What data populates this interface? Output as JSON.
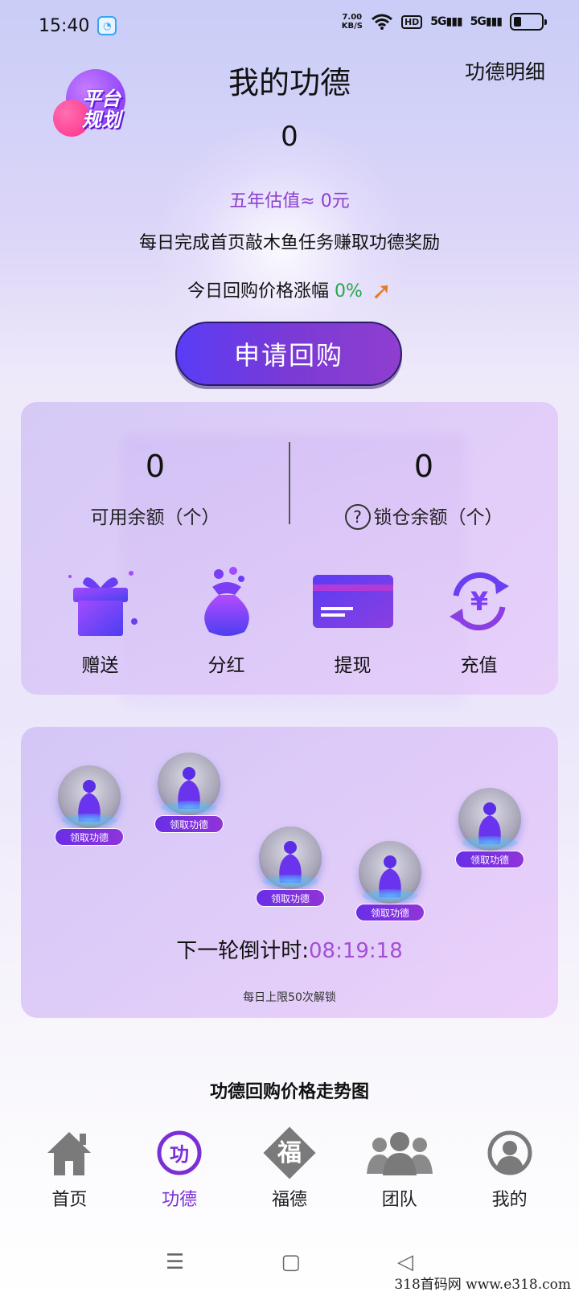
{
  "status_bar": {
    "time": "15:40",
    "net_speed_value": "7.00",
    "net_speed_unit": "KB/S",
    "icons": [
      "wifi-icon",
      "hd-icon",
      "signal-5g-icon",
      "signal-5g-icon",
      "battery-icon"
    ]
  },
  "header": {
    "title": "我的功德",
    "detail_link": "功德明细",
    "badge_text_line1": "平台",
    "badge_text_line2": "规划"
  },
  "merit": {
    "value": "0",
    "estimate": "五年估值≈ 0元",
    "tip": "每日完成首页敲木鱼任务赚取功德奖励",
    "price_rise_label": "今日回购价格涨幅",
    "price_rise_pct": "0%"
  },
  "buyback_button": "申请回购",
  "balance": {
    "available_value": "0",
    "available_label": "可用余额（个）",
    "locked_value": "0",
    "locked_label": "锁仓余额（个）"
  },
  "actions": [
    {
      "label": "赠送",
      "icon": "gift-icon"
    },
    {
      "label": "分红",
      "icon": "money-bag-icon"
    },
    {
      "label": "提现",
      "icon": "card-icon"
    },
    {
      "label": "充值",
      "icon": "yen-exchange-icon"
    }
  ],
  "collect": {
    "tag_label": "领取功德",
    "countdown_label": "下一轮倒计时:",
    "countdown_time": "08:19:18",
    "unlock_note": "每日上限50次解锁"
  },
  "trend_title": "功德回购价格走势图",
  "nav": [
    {
      "label": "首页",
      "icon": "home-icon",
      "active": false
    },
    {
      "label": "功德",
      "icon": "merit-icon",
      "active": true
    },
    {
      "label": "福德",
      "icon": "fu-icon",
      "active": false
    },
    {
      "label": "团队",
      "icon": "team-icon",
      "active": false
    },
    {
      "label": "我的",
      "icon": "profile-icon",
      "active": false
    }
  ],
  "colors": {
    "accent": "#7a2fd6",
    "button_gradient_start": "#5a3cf5",
    "green": "#21a84a",
    "countdown": "#a34fd6"
  },
  "watermark": "318首码网 www.e318.com"
}
